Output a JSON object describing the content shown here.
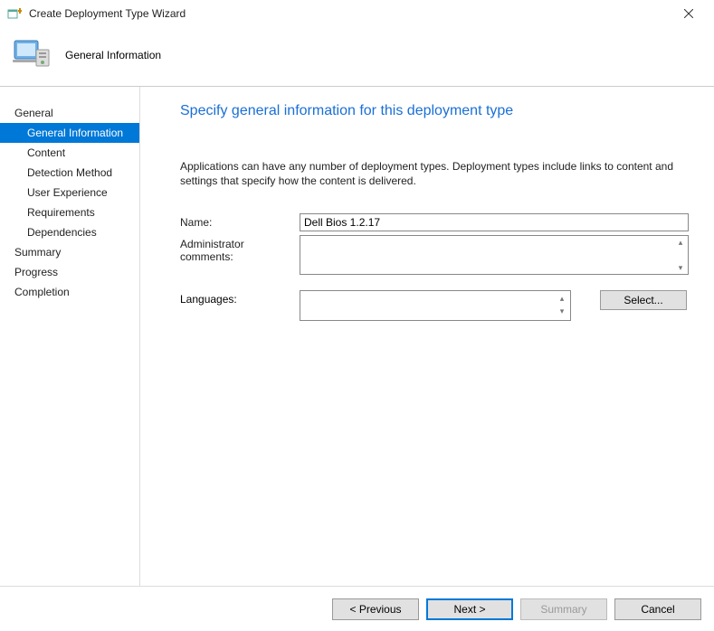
{
  "window": {
    "title": "Create Deployment Type Wizard"
  },
  "header": {
    "title": "General Information"
  },
  "sidebar": {
    "items": [
      {
        "label": "General",
        "indent": 0,
        "selected": false
      },
      {
        "label": "General Information",
        "indent": 1,
        "selected": true
      },
      {
        "label": "Content",
        "indent": 1,
        "selected": false
      },
      {
        "label": "Detection Method",
        "indent": 1,
        "selected": false
      },
      {
        "label": "User Experience",
        "indent": 1,
        "selected": false
      },
      {
        "label": "Requirements",
        "indent": 1,
        "selected": false
      },
      {
        "label": "Dependencies",
        "indent": 1,
        "selected": false
      },
      {
        "label": "Summary",
        "indent": 0,
        "selected": false
      },
      {
        "label": "Progress",
        "indent": 0,
        "selected": false
      },
      {
        "label": "Completion",
        "indent": 0,
        "selected": false
      }
    ]
  },
  "page": {
    "heading": "Specify general information for this deployment type",
    "instruction": "Applications can have any number of deployment types. Deployment types include links to content and settings that specify how the content is delivered.",
    "labels": {
      "name": "Name:",
      "comments": "Administrator comments:",
      "languages": "Languages:"
    },
    "fields": {
      "name": "Dell Bios 1.2.17",
      "comments": "",
      "languages": ""
    },
    "buttons": {
      "select": "Select..."
    }
  },
  "footer": {
    "previous": "< Previous",
    "next": "Next >",
    "summary": "Summary",
    "cancel": "Cancel"
  }
}
